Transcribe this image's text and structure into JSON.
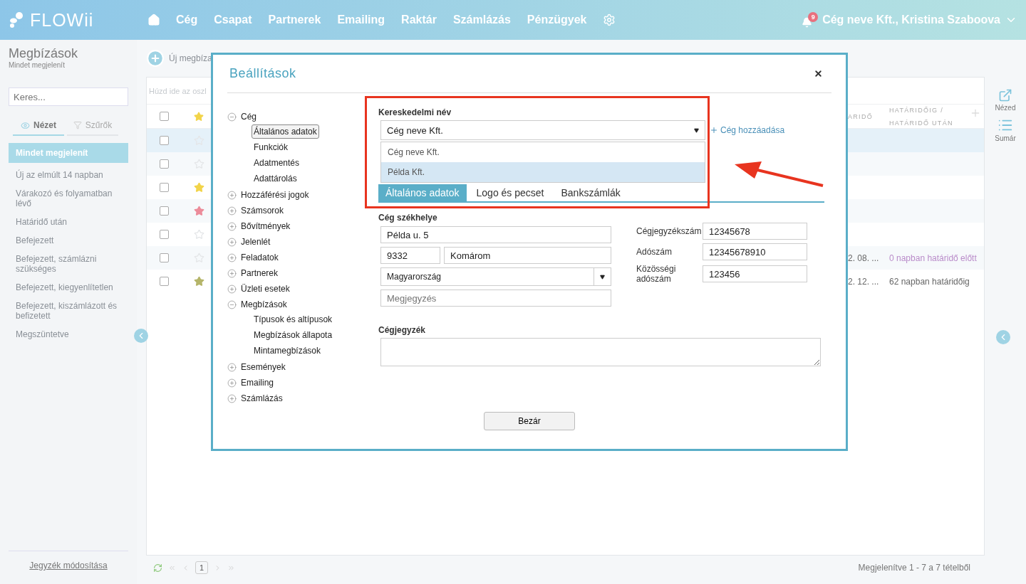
{
  "header": {
    "logo": "FLOWii",
    "nav": [
      "Cég",
      "Csapat",
      "Partnerek",
      "Emailing",
      "Raktár",
      "Számlázás",
      "Pénzügyek"
    ],
    "notifications": "9",
    "user": "Cég neve Kft., Kristina Szaboova"
  },
  "sidebar": {
    "title": "Megbízások",
    "subtitle": "Mindet megjelenít",
    "search": {
      "placeholder": "Keres..."
    },
    "tabs": [
      {
        "label": "Nézet",
        "selected": true
      },
      {
        "label": "Szűrők",
        "selected": false
      }
    ],
    "items": [
      {
        "label": "Mindet megjelenít",
        "selected": true
      },
      {
        "label": "Új az elmúlt 14 napban",
        "selected": false
      },
      {
        "label": "Várakozó és folyamatban lévő",
        "selected": false
      },
      {
        "label": "Határidő után",
        "selected": false
      },
      {
        "label": "Befejezett",
        "selected": false
      },
      {
        "label": "Befejezett, számlázni szükséges",
        "selected": false
      },
      {
        "label": "Befejezett, kiegyenlítetlen",
        "selected": false
      },
      {
        "label": "Befejezett, kiszámlázott és befizetett",
        "selected": false
      },
      {
        "label": "Megszüntetve",
        "selected": false
      }
    ],
    "footer_link": "Jegyzék módosítása"
  },
  "toolbar": {
    "new_button": "Új megbíza"
  },
  "grid": {
    "group_hint": "Húzd ide az oszl",
    "columns": [
      "ARIDŐ",
      "HATÁRIDŐIG / HATÁRIDŐ UTÁN"
    ],
    "select_all": {
      "checked": false
    },
    "rows": [
      {
        "selected": true,
        "star": {
          "filled": false
        }
      },
      {
        "selected": false,
        "star": {
          "filled": false
        }
      },
      {
        "selected": false,
        "star": {
          "filled": true,
          "color": "#f2d44a"
        }
      },
      {
        "selected": false,
        "star": {
          "filled": true,
          "color": "#ec8c9a"
        }
      },
      {
        "selected": false,
        "star": {
          "filled": false
        }
      },
      {
        "selected": false,
        "star": {
          "filled": false
        },
        "date": "2. 08. ...",
        "due": {
          "text": "0 napban határidő előtt",
          "color": "#b98bc9"
        }
      },
      {
        "selected": false,
        "star": {
          "filled": true,
          "color": "#b5b56a"
        },
        "date": "2. 12. ...",
        "due": {
          "text": "62 napban határidőig",
          "color": "#666666"
        }
      }
    ]
  },
  "pager": {
    "page": "1",
    "summary": "Megjelenítve 1 - 7 a 7 tételből"
  },
  "right_rail": [
    {
      "kind": "external",
      "label": "Nézed"
    },
    {
      "kind": "list",
      "label": "Sumár"
    }
  ],
  "modal": {
    "title": "Beállítások",
    "tree": [
      {
        "label": "Cég",
        "expanded": true,
        "children": [
          {
            "label": "Általános adatok",
            "selected": true
          },
          {
            "label": "Funkciók",
            "selected": false
          },
          {
            "label": "Adatmentés",
            "selected": false
          },
          {
            "label": "Adattárolás",
            "selected": false
          }
        ]
      },
      {
        "label": "Hozzáférési jogok",
        "expanded": false
      },
      {
        "label": "Számsorok",
        "expanded": false
      },
      {
        "label": "Bővítmények",
        "expanded": false
      },
      {
        "label": "Jelenlét",
        "expanded": false
      },
      {
        "label": "Feladatok",
        "expanded": false
      },
      {
        "label": "Partnerek",
        "expanded": false
      },
      {
        "label": "Üzleti esetek",
        "expanded": false
      },
      {
        "label": "Megbízások",
        "expanded": true,
        "children": [
          {
            "label": "Típusok és altípusok",
            "selected": false
          },
          {
            "label": "Megbízások állapota",
            "selected": false
          },
          {
            "label": "Mintamegbízások",
            "selected": false
          }
        ]
      },
      {
        "label": "Események",
        "expanded": false
      },
      {
        "label": "Emailing",
        "expanded": false
      },
      {
        "label": "Számlázás",
        "expanded": false
      }
    ],
    "trade_name": {
      "label": "Kereskedelmi név",
      "value": "Cég neve Kft.",
      "options": [
        {
          "label": "Cég neve Kft.",
          "highlighted": false
        },
        {
          "label": "Példa Kft.",
          "highlighted": true
        }
      ]
    },
    "add_link": "Cég hozzáadása",
    "tabs": [
      {
        "label": "Általános adatok",
        "selected": true
      },
      {
        "label": "Logo és pecset",
        "selected": false
      },
      {
        "label": "Bankszámlák",
        "selected": false
      }
    ],
    "address": {
      "label": "Cég székhelye",
      "street": "Példa u. 5",
      "zip": "9332",
      "city": "Komárom",
      "country": "Magyarország",
      "note": {
        "placeholder": "Megjegyzés"
      }
    },
    "ids": [
      {
        "label": "Cégjegyzékszám",
        "value": "12345678"
      },
      {
        "label": "Adószám",
        "value": "12345678910"
      },
      {
        "label": "Közösségi adószám",
        "value": "123456"
      }
    ],
    "registry": {
      "label": "Cégjegyzék"
    },
    "close_button": "Bezár"
  }
}
